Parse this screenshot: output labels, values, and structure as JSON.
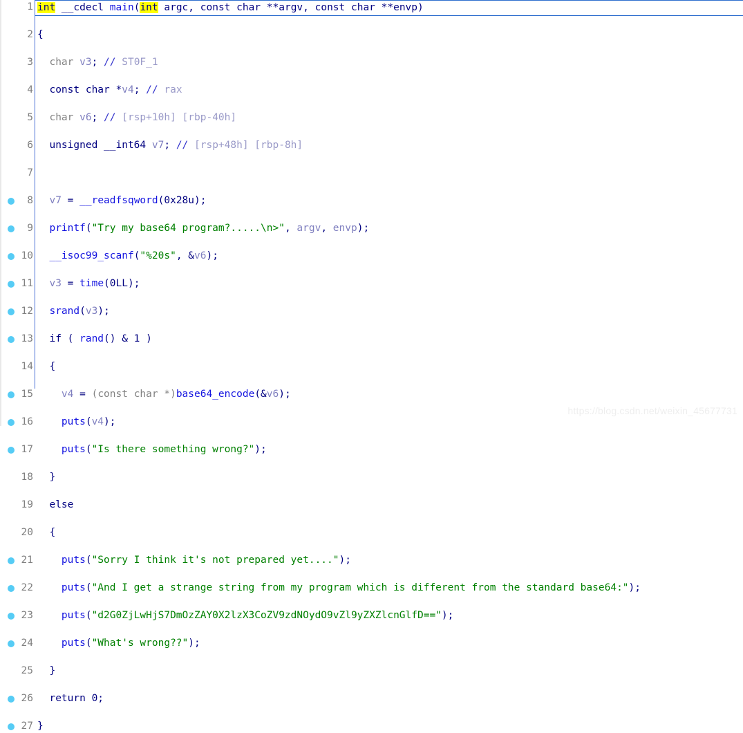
{
  "editor": {
    "name": "pseudocode-view",
    "language": "C",
    "colors": {
      "background": "#ffffff",
      "keyword": "#000080",
      "function": "#1515e0",
      "string": "#008000",
      "comment": "#9a9ac8",
      "variable": "#8080c0",
      "type_faded": "#808080",
      "highlight": "#ffff00",
      "gutter_dot": "#56ccf5",
      "line_number": "#808080",
      "current_line_border": "#2f6fce",
      "rule": "#4a6fd4"
    }
  },
  "watermark": {
    "text": "https://blog.csdn.net/weixin_45677731"
  },
  "lines": [
    {
      "num": "1",
      "dot": false,
      "current": true,
      "tokens": [
        {
          "c": "hl",
          "t": "int"
        },
        {
          "c": "plain",
          "t": " __cdecl "
        },
        {
          "c": "fn",
          "t": "main"
        },
        {
          "c": "plain",
          "t": "("
        },
        {
          "c": "hl",
          "t": "int"
        },
        {
          "c": "plain",
          "t": " argc, const char **argv, const char **envp)"
        }
      ]
    },
    {
      "num": "2",
      "dot": false,
      "current": false,
      "tokens": [
        {
          "c": "plain",
          "t": "{"
        }
      ]
    },
    {
      "num": "3",
      "dot": false,
      "current": false,
      "tokens": [
        {
          "c": "type",
          "t": "  char "
        },
        {
          "c": "var",
          "t": "v3"
        },
        {
          "c": "plain",
          "t": "; "
        },
        {
          "c": "cmtmark",
          "t": "//"
        },
        {
          "c": "cmt",
          "t": " ST0F_1"
        }
      ]
    },
    {
      "num": "4",
      "dot": false,
      "current": false,
      "tokens": [
        {
          "c": "plain",
          "t": "  const char *"
        },
        {
          "c": "var",
          "t": "v4"
        },
        {
          "c": "plain",
          "t": "; "
        },
        {
          "c": "cmtmark",
          "t": "//"
        },
        {
          "c": "cmt",
          "t": " rax"
        }
      ]
    },
    {
      "num": "5",
      "dot": false,
      "current": false,
      "tokens": [
        {
          "c": "type",
          "t": "  char "
        },
        {
          "c": "var",
          "t": "v6"
        },
        {
          "c": "plain",
          "t": "; "
        },
        {
          "c": "cmtmark",
          "t": "//"
        },
        {
          "c": "cmt",
          "t": " [rsp+10h] [rbp-40h]"
        }
      ]
    },
    {
      "num": "6",
      "dot": false,
      "current": false,
      "tokens": [
        {
          "c": "plain",
          "t": "  unsigned __int64 "
        },
        {
          "c": "var",
          "t": "v7"
        },
        {
          "c": "plain",
          "t": "; "
        },
        {
          "c": "cmtmark",
          "t": "//"
        },
        {
          "c": "cmt",
          "t": " [rsp+48h] [rbp-8h]"
        }
      ]
    },
    {
      "num": "7",
      "dot": false,
      "current": false,
      "tokens": []
    },
    {
      "num": "8",
      "dot": true,
      "current": false,
      "tokens": [
        {
          "c": "var",
          "t": "  v7"
        },
        {
          "c": "plain",
          "t": " = "
        },
        {
          "c": "fn",
          "t": "__readfsqword"
        },
        {
          "c": "plain",
          "t": "(0x28u);"
        }
      ]
    },
    {
      "num": "9",
      "dot": true,
      "current": false,
      "tokens": [
        {
          "c": "fn",
          "t": "  printf"
        },
        {
          "c": "plain",
          "t": "("
        },
        {
          "c": "str",
          "t": "\"Try my base64 program?.....\\n>\""
        },
        {
          "c": "plain",
          "t": ", "
        },
        {
          "c": "var",
          "t": "argv"
        },
        {
          "c": "plain",
          "t": ", "
        },
        {
          "c": "var",
          "t": "envp"
        },
        {
          "c": "plain",
          "t": ");"
        }
      ]
    },
    {
      "num": "10",
      "dot": true,
      "current": false,
      "tokens": [
        {
          "c": "fn",
          "t": "  __isoc99_scanf"
        },
        {
          "c": "plain",
          "t": "("
        },
        {
          "c": "str",
          "t": "\"%20s\""
        },
        {
          "c": "plain",
          "t": ", &"
        },
        {
          "c": "var",
          "t": "v6"
        },
        {
          "c": "plain",
          "t": ");"
        }
      ]
    },
    {
      "num": "11",
      "dot": true,
      "current": false,
      "tokens": [
        {
          "c": "var",
          "t": "  v3"
        },
        {
          "c": "plain",
          "t": " = "
        },
        {
          "c": "fn",
          "t": "time"
        },
        {
          "c": "plain",
          "t": "(0LL);"
        }
      ]
    },
    {
      "num": "12",
      "dot": true,
      "current": false,
      "tokens": [
        {
          "c": "fn",
          "t": "  srand"
        },
        {
          "c": "plain",
          "t": "("
        },
        {
          "c": "var",
          "t": "v3"
        },
        {
          "c": "plain",
          "t": ");"
        }
      ]
    },
    {
      "num": "13",
      "dot": true,
      "current": false,
      "tokens": [
        {
          "c": "plain",
          "t": "  if ( "
        },
        {
          "c": "fn",
          "t": "rand"
        },
        {
          "c": "plain",
          "t": "() & 1 )"
        }
      ]
    },
    {
      "num": "14",
      "dot": false,
      "current": false,
      "tokens": [
        {
          "c": "plain",
          "t": "  {"
        }
      ]
    },
    {
      "num": "15",
      "dot": true,
      "current": false,
      "tokens": [
        {
          "c": "var",
          "t": "    v4"
        },
        {
          "c": "plain",
          "t": " = "
        },
        {
          "c": "type",
          "t": "(const char *)"
        },
        {
          "c": "fn",
          "t": "base64_encode"
        },
        {
          "c": "plain",
          "t": "(&"
        },
        {
          "c": "var",
          "t": "v6"
        },
        {
          "c": "plain",
          "t": ");"
        }
      ]
    },
    {
      "num": "16",
      "dot": true,
      "current": false,
      "tokens": [
        {
          "c": "fn",
          "t": "    puts"
        },
        {
          "c": "plain",
          "t": "("
        },
        {
          "c": "var",
          "t": "v4"
        },
        {
          "c": "plain",
          "t": ");"
        }
      ]
    },
    {
      "num": "17",
      "dot": true,
      "current": false,
      "tokens": [
        {
          "c": "fn",
          "t": "    puts"
        },
        {
          "c": "plain",
          "t": "("
        },
        {
          "c": "str",
          "t": "\"Is there something wrong?\""
        },
        {
          "c": "plain",
          "t": ");"
        }
      ]
    },
    {
      "num": "18",
      "dot": false,
      "current": false,
      "tokens": [
        {
          "c": "plain",
          "t": "  }"
        }
      ]
    },
    {
      "num": "19",
      "dot": false,
      "current": false,
      "tokens": [
        {
          "c": "plain",
          "t": "  else"
        }
      ]
    },
    {
      "num": "20",
      "dot": false,
      "current": false,
      "tokens": [
        {
          "c": "plain",
          "t": "  {"
        }
      ]
    },
    {
      "num": "21",
      "dot": true,
      "current": false,
      "tokens": [
        {
          "c": "fn",
          "t": "    puts"
        },
        {
          "c": "plain",
          "t": "("
        },
        {
          "c": "str",
          "t": "\"Sorry I think it's not prepared yet....\""
        },
        {
          "c": "plain",
          "t": ");"
        }
      ]
    },
    {
      "num": "22",
      "dot": true,
      "current": false,
      "tokens": [
        {
          "c": "fn",
          "t": "    puts"
        },
        {
          "c": "plain",
          "t": "("
        },
        {
          "c": "str",
          "t": "\"And I get a strange string from my program which is different from the standard base64:\""
        },
        {
          "c": "plain",
          "t": ");"
        }
      ]
    },
    {
      "num": "23",
      "dot": true,
      "current": false,
      "tokens": [
        {
          "c": "fn",
          "t": "    puts"
        },
        {
          "c": "plain",
          "t": "("
        },
        {
          "c": "str",
          "t": "\"d2G0ZjLwHjS7DmOzZAY0X2lzX3CoZV9zdNOydO9vZl9yZXZlcnGlfD==\""
        },
        {
          "c": "plain",
          "t": ");"
        }
      ]
    },
    {
      "num": "24",
      "dot": true,
      "current": false,
      "tokens": [
        {
          "c": "fn",
          "t": "    puts"
        },
        {
          "c": "plain",
          "t": "("
        },
        {
          "c": "str",
          "t": "\"What's wrong??\""
        },
        {
          "c": "plain",
          "t": ");"
        }
      ]
    },
    {
      "num": "25",
      "dot": false,
      "current": false,
      "tokens": [
        {
          "c": "plain",
          "t": "  }"
        }
      ]
    },
    {
      "num": "26",
      "dot": true,
      "current": false,
      "tokens": [
        {
          "c": "plain",
          "t": "  return 0;"
        }
      ]
    },
    {
      "num": "27",
      "dot": true,
      "current": false,
      "tokens": [
        {
          "c": "plain",
          "t": "}"
        }
      ]
    }
  ]
}
